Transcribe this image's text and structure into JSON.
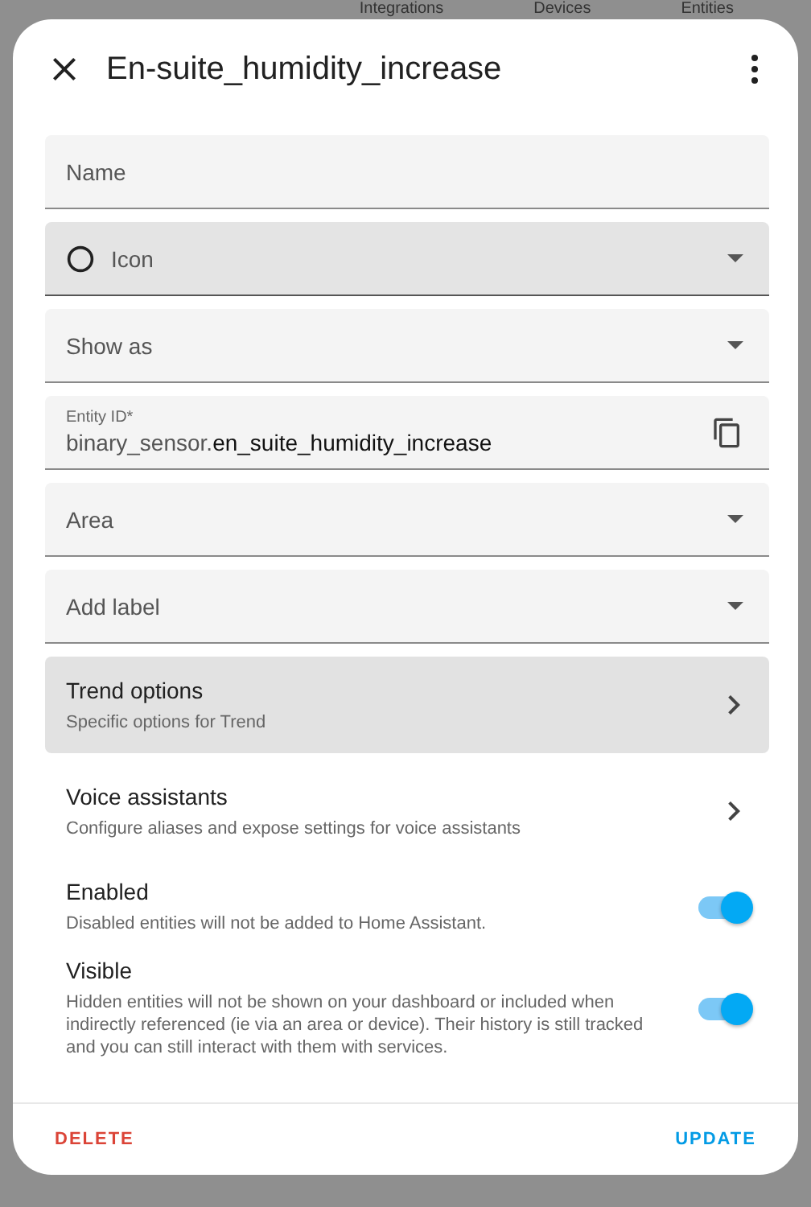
{
  "background_tabs": [
    "Integrations",
    "Devices",
    "Entities"
  ],
  "dialog": {
    "title": "En-suite_humidity_increase",
    "fields": [
      {
        "kind": "text",
        "label": "Name",
        "highlighted": false
      },
      {
        "kind": "icon",
        "label": "Icon",
        "highlighted": true
      },
      {
        "kind": "select",
        "label": "Show as",
        "highlighted": false
      },
      {
        "kind": "entity",
        "label": "Entity ID*",
        "prefix": "binary_sensor.",
        "value": "en_suite_humidity_increase",
        "highlighted": false
      },
      {
        "kind": "select",
        "label": "Area",
        "highlighted": false
      },
      {
        "kind": "select",
        "label": "Add label",
        "highlighted": false
      }
    ],
    "links": [
      {
        "title": "Trend options",
        "subtitle": "Specific options for Trend",
        "highlighted": true
      },
      {
        "title": "Voice assistants",
        "subtitle": "Configure aliases and expose settings for voice assistants",
        "highlighted": false
      }
    ],
    "toggles": [
      {
        "title": "Enabled",
        "description": "Disabled entities will not be added to Home Assistant.",
        "on": true
      },
      {
        "title": "Visible",
        "description": "Hidden entities will not be shown on your dashboard or included when indirectly referenced (ie via an area or device). Their history is still tracked and you can still interact with them with services.",
        "on": true
      }
    ],
    "buttons": [
      {
        "label": "DELETE",
        "kind": "danger"
      },
      {
        "label": "UPDATE",
        "kind": "primary"
      }
    ]
  }
}
